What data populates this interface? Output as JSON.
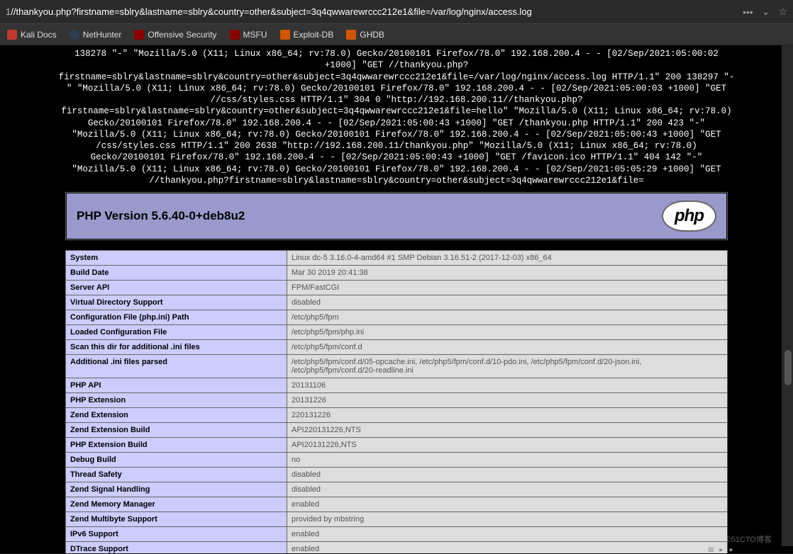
{
  "url": {
    "prefix": "1",
    "highlighted": "//thankyou.php?firstname=sblry&lastname=sblry&country=other&subject=3q4qwwarewrccc212e1&file=/var/log/nginx/access.log"
  },
  "bookmarks": [
    {
      "label": "Kali Docs",
      "icon": "ico-red"
    },
    {
      "label": "NetHunter",
      "icon": "ico-blue"
    },
    {
      "label": "Offensive Security",
      "icon": "ico-dark"
    },
    {
      "label": "MSFU",
      "icon": "ico-dark"
    },
    {
      "label": "Exploit-DB",
      "icon": "ico-orange"
    },
    {
      "label": "GHDB",
      "icon": "ico-orange"
    }
  ],
  "log": "138278 \"-\" \"Mozilla/5.0 (X11; Linux x86_64; rv:78.0) Gecko/20100101 Firefox/78.0\" 192.168.200.4 - - [02/Sep/2021:05:00:02 +1000] \"GET //thankyou.php?firstname=sblry&lastname=sblry&country=other&subject=3q4qwwarewrccc212e1&file=/var/log/nginx/access.log HTTP/1.1\" 200 138297 \"-\" \"Mozilla/5.0 (X11; Linux x86_64; rv:78.0) Gecko/20100101 Firefox/78.0\" 192.168.200.4 - - [02/Sep/2021:05:00:03 +1000] \"GET //css/styles.css HTTP/1.1\" 304 0 \"http://192.168.200.11//thankyou.php?firstname=sblry&lastname=sblry&country=other&subject=3q4qwwarewrccc212e1&file=hello\" \"Mozilla/5.0 (X11; Linux x86_64; rv:78.0) Gecko/20100101 Firefox/78.0\" 192.168.200.4 - - [02/Sep/2021:05:00:43 +1000] \"GET /thankyou.php HTTP/1.1\" 200 423 \"-\" \"Mozilla/5.0 (X11; Linux x86_64; rv:78.0) Gecko/20100101 Firefox/78.0\" 192.168.200.4 - - [02/Sep/2021:05:00:43 +1000] \"GET /css/styles.css HTTP/1.1\" 200 2638 \"http://192.168.200.11/thankyou.php\" \"Mozilla/5.0 (X11; Linux x86_64; rv:78.0) Gecko/20100101 Firefox/78.0\" 192.168.200.4 - - [02/Sep/2021:05:00:43 +1000] \"GET /favicon.ico HTTP/1.1\" 404 142 \"-\" \"Mozilla/5.0 (X11; Linux x86_64; rv:78.0) Gecko/20100101 Firefox/78.0\" 192.168.200.4 - - [02/Sep/2021:05:05:29 +1000] \"GET //thankyou.php?firstname=sblry&lastname=sblry&country=other&subject=3q4qwwarewrccc212e1&file=",
  "php_title": "PHP Version 5.6.40-0+deb8u2",
  "php_logo": "php",
  "rows": [
    {
      "k": "System",
      "v": "Linux dc-5 3.16.0-4-amd64 #1 SMP Debian 3.16.51-2 (2017-12-03) x86_64"
    },
    {
      "k": "Build Date",
      "v": "Mar 30 2019 20:41:38"
    },
    {
      "k": "Server API",
      "v": "FPM/FastCGI"
    },
    {
      "k": "Virtual Directory Support",
      "v": "disabled"
    },
    {
      "k": "Configuration File (php.ini) Path",
      "v": "/etc/php5/fpm"
    },
    {
      "k": "Loaded Configuration File",
      "v": "/etc/php5/fpm/php.ini"
    },
    {
      "k": "Scan this dir for additional .ini files",
      "v": "/etc/php5/fpm/conf.d"
    },
    {
      "k": "Additional .ini files parsed",
      "v": "/etc/php5/fpm/conf.d/05-opcache.ini, /etc/php5/fpm/conf.d/10-pdo.ini, /etc/php5/fpm/conf.d/20-json.ini, /etc/php5/fpm/conf.d/20-readline.ini"
    },
    {
      "k": "PHP API",
      "v": "20131106"
    },
    {
      "k": "PHP Extension",
      "v": "20131226"
    },
    {
      "k": "Zend Extension",
      "v": "220131226"
    },
    {
      "k": "Zend Extension Build",
      "v": "API220131226,NTS"
    },
    {
      "k": "PHP Extension Build",
      "v": "API20131226,NTS"
    },
    {
      "k": "Debug Build",
      "v": "no"
    },
    {
      "k": "Thread Safety",
      "v": "disabled"
    },
    {
      "k": "Zend Signal Handling",
      "v": "disabled"
    },
    {
      "k": "Zend Memory Manager",
      "v": "enabled"
    },
    {
      "k": "Zend Multibyte Support",
      "v": "provided by mbstring"
    },
    {
      "k": "IPv6 Support",
      "v": "enabled"
    },
    {
      "k": "DTrace Support",
      "v": "enabled"
    }
  ],
  "watermark": "©51CTO博客"
}
